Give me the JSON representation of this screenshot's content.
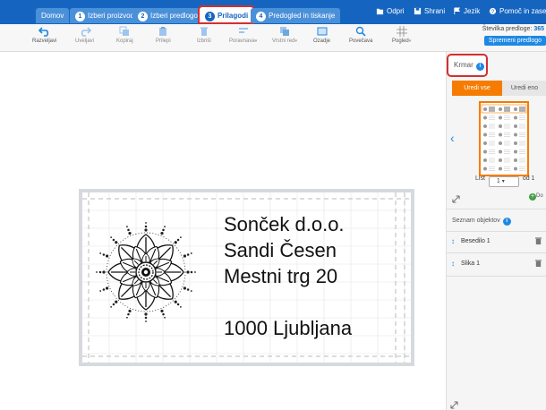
{
  "tabs": [
    {
      "num": "",
      "label": "Domov"
    },
    {
      "num": "1",
      "label": "Izberi proizvod"
    },
    {
      "num": "2",
      "label": "Izberi predlogo"
    },
    {
      "num": "3",
      "label": "Prilagodi"
    },
    {
      "num": "4",
      "label": "Predogled in tiskanje"
    }
  ],
  "top_actions": {
    "open": "Odpri",
    "save": "Shrani",
    "language": "Jezik",
    "help": "Pomoč in zasebnost"
  },
  "toolbar": {
    "undo": "Razveljavi",
    "redo": "Uveljavi",
    "copy": "Kopiraj",
    "paste": "Prilepi",
    "delete": "Izbriši",
    "align": "Poravnava",
    "order": "Vrstni red",
    "background": "Ozadje",
    "zoom": "Povečava",
    "view": "Pogled"
  },
  "template": {
    "number_label": "Številka predloge:",
    "number_value": "365",
    "change_button": "Spremeni predlogo"
  },
  "label": {
    "lines": [
      "Sonček d.o.o.",
      "Sandi Česen",
      "Mestni trg 20",
      "1000 Ljubljana"
    ]
  },
  "right_panel": {
    "krmar": "Krmar",
    "edit_all": "Uredi vse",
    "edit_one": "Uredi eno",
    "page_prefix": "List",
    "page_value": "1",
    "page_suffix": "od 1",
    "add_label": "Do",
    "object_list_title": "Seznam objektov",
    "objects": [
      "Besedilo 1",
      "Slika 1"
    ]
  },
  "colors": {
    "topbar": "#1565c0",
    "tab": "#4a90d9",
    "accent_orange": "#f57c00",
    "highlight_red": "#d32f2f"
  }
}
